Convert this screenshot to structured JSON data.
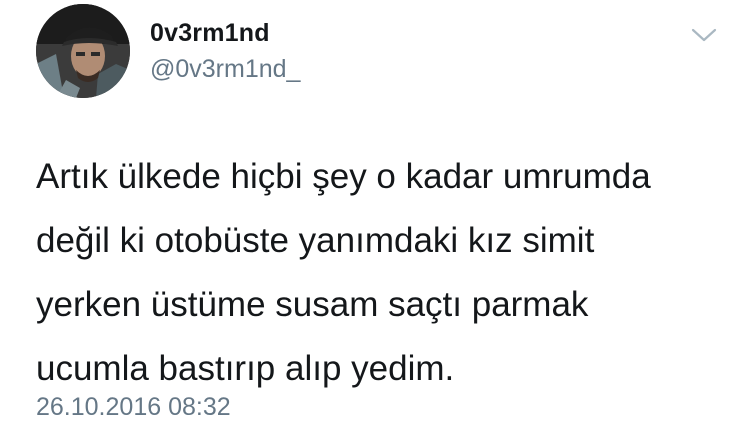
{
  "tweet": {
    "author": {
      "display_name": "0v3rm1nd",
      "handle": "@0v3rm1nd_",
      "avatar_icon": "profile-photo"
    },
    "menu_icon": "chevron-down-icon",
    "text_lines": [
      "Artık ülkede hiçbi şey o kadar umrumda",
      "değil ki otobüste yanımdaki kız simit",
      "yerken üstüme susam saçtı parmak",
      "ucumla bastırıp alıp yedim."
    ],
    "timestamp": "26.10.2016 08:32"
  },
  "colors": {
    "text_primary": "#14171a",
    "text_secondary": "#657786",
    "chevron": "#aab8c2",
    "background": "#ffffff"
  }
}
